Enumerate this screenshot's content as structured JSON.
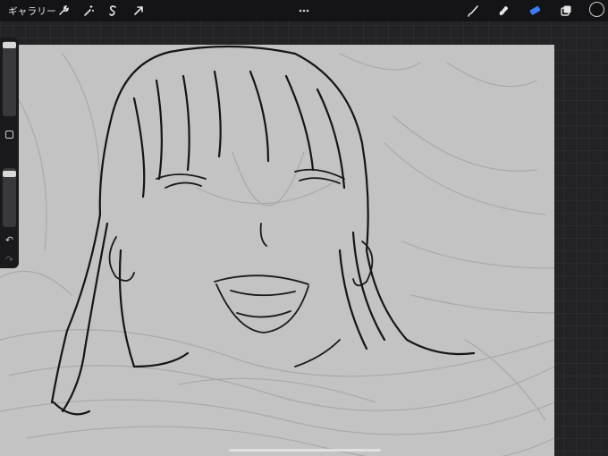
{
  "topbar": {
    "gallery_label": "ギャラリー",
    "left_tools": [
      "wrench-icon",
      "magic-wand-icon",
      "selection-s-icon",
      "transform-arrow-icon"
    ],
    "right_tools": [
      "brush-icon",
      "smudge-icon",
      "eraser-icon",
      "layers-icon"
    ],
    "active_tool": "eraser-icon",
    "accent_color": "#3a7bff",
    "current_color": "#101010"
  },
  "sidebar": {
    "size_slider_level": 0.05,
    "opacity_slider_level": 0.05,
    "modify_icon": "square-icon",
    "undo_icon": "undo-icon",
    "redo_icon": "redo-icon"
  },
  "canvas": {
    "background": "#c3c3c3",
    "subject": "line-art-sketch"
  }
}
